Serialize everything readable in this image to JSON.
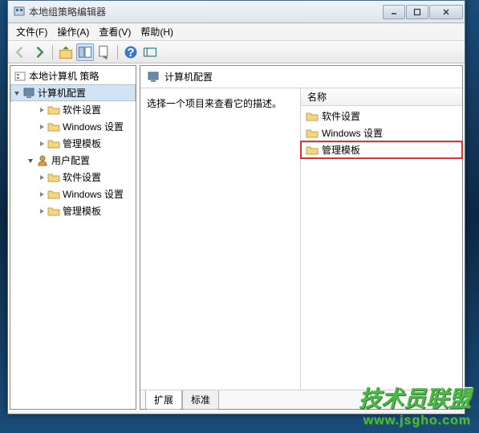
{
  "window": {
    "title": "本地组策略编辑器"
  },
  "menu": {
    "file": "文件(F)",
    "action": "操作(A)",
    "view": "查看(V)",
    "help": "帮助(H)"
  },
  "tree": {
    "root": "本地计算机 策略",
    "computer_config": "计算机配置",
    "user_config": "用户配置",
    "software_settings": "软件设置",
    "windows_settings": "Windows 设置",
    "admin_templates": "管理模板"
  },
  "right": {
    "header": "计算机配置",
    "description": "选择一个项目来查看它的描述。",
    "column_name": "名称",
    "items": {
      "software": "软件设置",
      "windows": "Windows 设置",
      "admin": "管理模板"
    }
  },
  "tabs": {
    "extended": "扩展",
    "standard": "标准"
  },
  "watermark": {
    "text": "技术员联盟",
    "url": "www.jsgho.com"
  }
}
